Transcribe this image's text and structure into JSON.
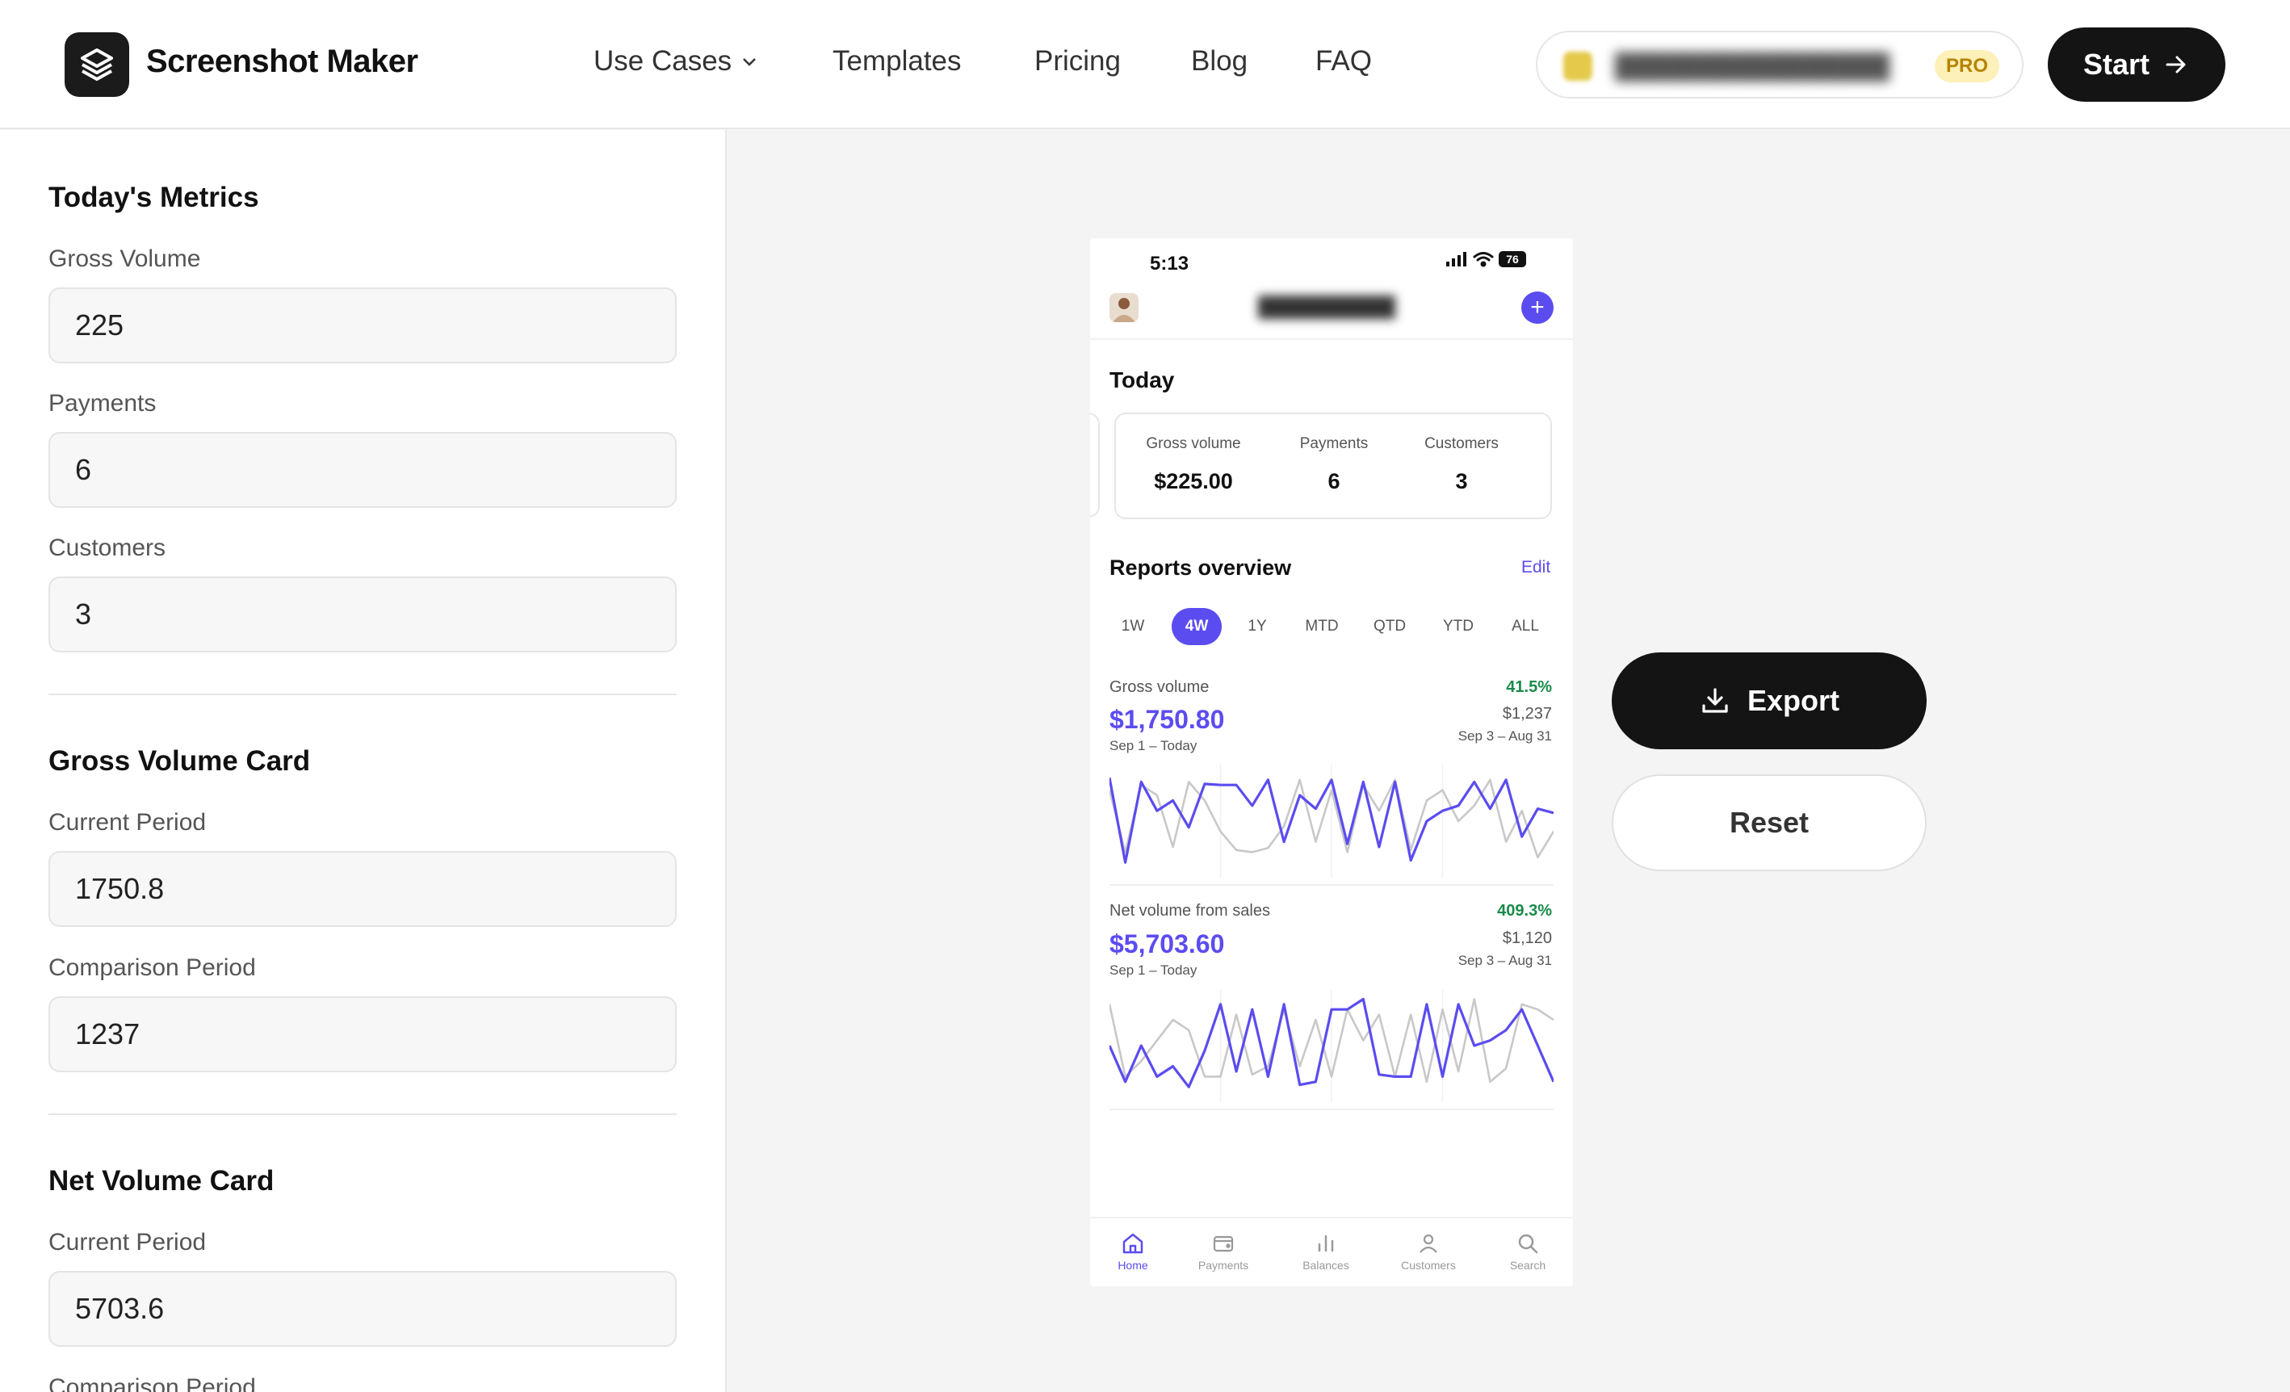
{
  "app": {
    "brand": "Screenshot Maker"
  },
  "nav": {
    "items": [
      {
        "label": "Use Cases",
        "dropdown": true
      },
      {
        "label": "Templates"
      },
      {
        "label": "Pricing"
      },
      {
        "label": "Blog"
      },
      {
        "label": "FAQ"
      }
    ],
    "account_badge": "PRO",
    "start_label": "Start"
  },
  "sidebar": {
    "todays_metrics": {
      "title": "Today's Metrics",
      "gross_volume": {
        "label": "Gross Volume",
        "value": "225"
      },
      "payments": {
        "label": "Payments",
        "value": "6"
      },
      "customers": {
        "label": "Customers",
        "value": "3"
      }
    },
    "gross_volume_card": {
      "title": "Gross Volume Card",
      "current_period": {
        "label": "Current Period",
        "value": "1750.8"
      },
      "comparison_period": {
        "label": "Comparison Period",
        "value": "1237"
      }
    },
    "net_volume_card": {
      "title": "Net Volume Card",
      "current_period": {
        "label": "Current Period",
        "value": "5703.6"
      },
      "comparison_period": {
        "label": "Comparison Period"
      }
    }
  },
  "phone": {
    "time": "5:13",
    "battery": "76",
    "today_title": "Today",
    "metrics": [
      {
        "label": "Gross volume",
        "value": "$225.00"
      },
      {
        "label": "Payments",
        "value": "6"
      },
      {
        "label": "Customers",
        "value": "3"
      }
    ],
    "reports_title": "Reports overview",
    "edit_label": "Edit",
    "tabs": [
      "1W",
      "4W",
      "1Y",
      "MTD",
      "QTD",
      "YTD",
      "ALL"
    ],
    "active_tab": "4W",
    "gross_chart": {
      "label": "Gross volume",
      "change": "41.5%",
      "current": "$1,750.80",
      "current_range": "Sep 1 – Today",
      "comparison": "$1,237",
      "comparison_range": "Sep 3 – Aug 31"
    },
    "net_chart": {
      "label": "Net volume from sales",
      "change": "409.3%",
      "current": "$5,703.60",
      "current_range": "Sep 1 – Today",
      "comparison": "$1,120",
      "comparison_range": "Sep 3 – Aug 31"
    },
    "bottom_nav": [
      "Home",
      "Payments",
      "Balances",
      "Customers",
      "Search"
    ],
    "active_bottom": "Home"
  },
  "chart_data": [
    {
      "type": "line",
      "x": [
        1,
        2,
        3,
        4,
        5,
        6,
        7,
        8,
        9,
        10,
        11,
        12,
        13,
        14,
        15,
        16,
        17,
        18,
        19,
        20,
        21,
        22,
        23,
        24,
        25,
        26,
        27,
        28,
        29
      ],
      "series": [
        {
          "values": [
            92,
            10,
            88,
            60,
            70,
            44,
            86,
            85,
            85,
            65,
            90,
            30,
            75,
            62,
            90,
            28,
            88,
            25,
            88,
            12,
            50,
            60,
            65,
            88,
            62,
            90,
            35,
            62,
            58
          ]
        },
        {
          "values": [
            80,
            20,
            85,
            75,
            25,
            88,
            70,
            40,
            22,
            20,
            24,
            45,
            90,
            30,
            80,
            20,
            85,
            60,
            90,
            22,
            70,
            80,
            50,
            65,
            90,
            30,
            60,
            15,
            40
          ]
        }
      ],
      "colors": [
        "#5b4cf0",
        "#c8c8c8"
      ]
    },
    {
      "type": "line",
      "x": [
        1,
        2,
        3,
        4,
        5,
        6,
        7,
        8,
        9,
        10,
        11,
        12,
        13,
        14,
        15,
        16,
        17,
        18,
        19,
        20,
        21,
        22,
        23,
        24,
        25,
        26,
        27,
        28,
        29
      ],
      "series": [
        {
          "values": [
            50,
            15,
            50,
            20,
            30,
            10,
            45,
            90,
            25,
            85,
            20,
            90,
            12,
            15,
            85,
            85,
            95,
            22,
            20,
            20,
            90,
            20,
            90,
            50,
            55,
            65,
            85,
            50,
            15
          ]
        },
        {
          "values": [
            90,
            20,
            35,
            55,
            75,
            65,
            20,
            20,
            80,
            22,
            30,
            85,
            30,
            75,
            20,
            85,
            55,
            80,
            20,
            80,
            15,
            85,
            25,
            95,
            15,
            28,
            90,
            85,
            75
          ]
        }
      ],
      "colors": [
        "#5b4cf0",
        "#c8c8c8"
      ]
    }
  ]
}
